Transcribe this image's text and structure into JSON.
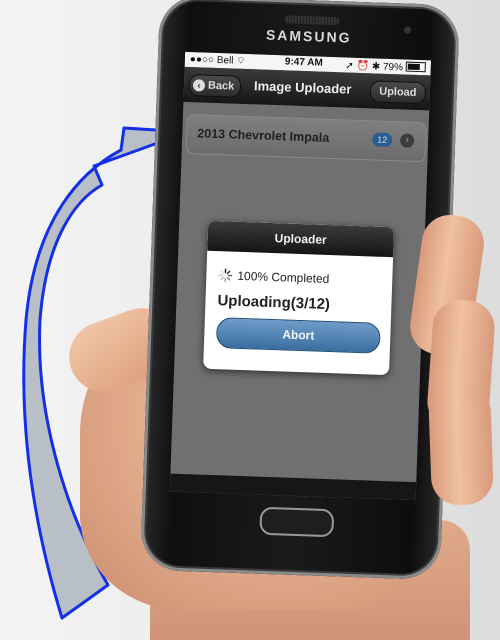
{
  "phone": {
    "brand": "SAMSUNG"
  },
  "status_bar": {
    "carrier": "●●○○ Bell",
    "time": "9:47 AM",
    "battery": "79%"
  },
  "nav": {
    "back_label": "Back",
    "title": "Image Uploader",
    "upload_label": "Upload"
  },
  "list": {
    "items": [
      {
        "label": "2013 Chevrolet Impala",
        "count": "12"
      }
    ]
  },
  "dialog": {
    "title": "Uploader",
    "progress_text": "100% Completed",
    "status_text": "Uploading(3/12)",
    "abort_label": "Abort"
  },
  "colors": {
    "arrow_fill": "#b9bfc6",
    "arrow_stroke": "#1430e6",
    "abort_button": "#4b7fb1",
    "badge": "#2b5e8c"
  },
  "icons": [
    "wifi-icon",
    "location-icon",
    "alarm-icon",
    "bluetooth-icon",
    "battery-icon",
    "back-chevron-icon",
    "chevron-right-icon",
    "spinner-icon"
  ]
}
